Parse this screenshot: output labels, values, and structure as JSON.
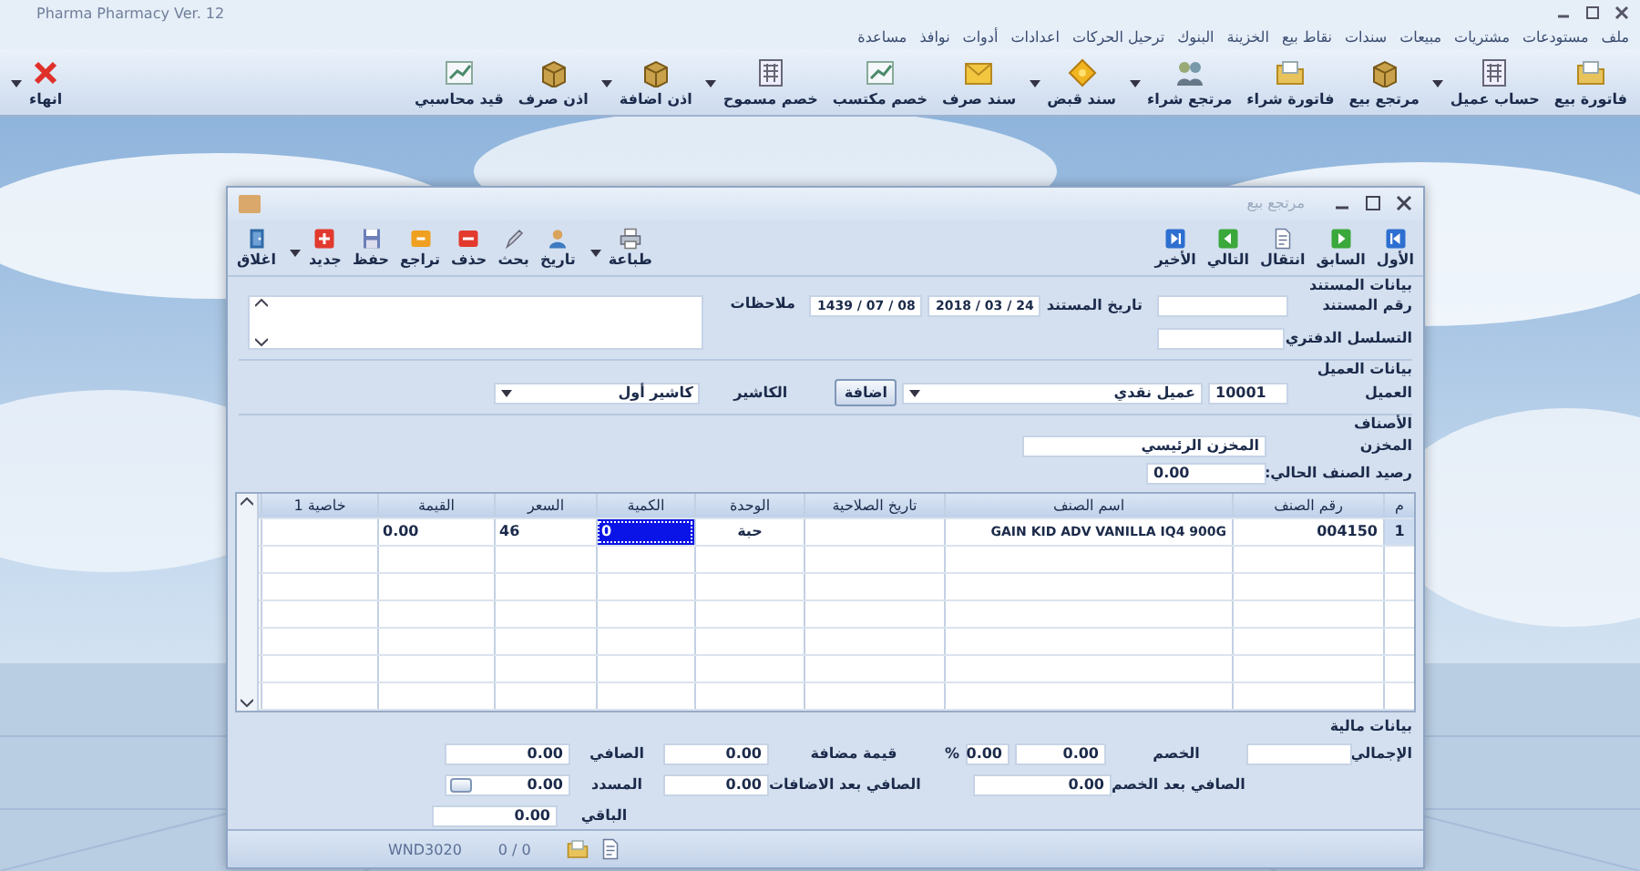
{
  "app": {
    "title": "Pharma Pharmacy Ver. 12"
  },
  "menu": [
    {
      "label": "ملف"
    },
    {
      "label": "مستودعات"
    },
    {
      "label": "مشتريات"
    },
    {
      "label": "مبيعات"
    },
    {
      "label": "سندات"
    },
    {
      "label": "نقاط بيع"
    },
    {
      "label": "الخزينة"
    },
    {
      "label": "البنوك"
    },
    {
      "label": "ترحيل الحركات"
    },
    {
      "label": "اعدادات"
    },
    {
      "label": "أدوات"
    },
    {
      "label": "نوافذ"
    },
    {
      "label": "مساعدة"
    }
  ],
  "toolbar": [
    {
      "label": "فاتورة بيع",
      "dropdown": false
    },
    {
      "label": "حساب عميل",
      "dropdown": true
    },
    {
      "label": "مرتجع بيع",
      "dropdown": false
    },
    {
      "label": "فاتورة شراء",
      "dropdown": false
    },
    {
      "label": "مرتجع شراء",
      "dropdown": true
    },
    {
      "label": "سند قبض",
      "dropdown": true
    },
    {
      "label": "سند صرف",
      "dropdown": false
    },
    {
      "label": "خصم مكتسب",
      "dropdown": false
    },
    {
      "label": "خصم مسموح",
      "dropdown": true
    },
    {
      "label": "اذن اضافة",
      "dropdown": true
    },
    {
      "label": "اذن صرف",
      "dropdown": false
    },
    {
      "label": "قيد محاسبي",
      "dropdown": false
    },
    {
      "label": "انهاء",
      "dropdown": true
    }
  ],
  "dialog": {
    "title": "مرتجع بيع",
    "nav": [
      {
        "label": "الأول"
      },
      {
        "label": "السابق"
      },
      {
        "label": "انتقال"
      },
      {
        "label": "التالي"
      },
      {
        "label": "الأخير"
      }
    ],
    "actions": [
      {
        "label": "طباعة",
        "dropdown": true
      },
      {
        "label": "تاريخ",
        "dropdown": false
      },
      {
        "label": "بحث",
        "dropdown": false
      },
      {
        "label": "حذف",
        "dropdown": false
      },
      {
        "label": "تراجع",
        "dropdown": false
      },
      {
        "label": "حفظ",
        "dropdown": false
      },
      {
        "label": "جديد",
        "dropdown": true
      },
      {
        "label": "اغلاق",
        "dropdown": false
      }
    ],
    "document": {
      "heading": "بيانات المستند",
      "number_label": "رقم المستند",
      "serial_label": "التسلسل الدفتري",
      "date_label": "تاريخ المستند",
      "date": "2018 / 03 / 24",
      "hijri_date": "1439 / 07 / 08",
      "notes_label": "ملاحظات"
    },
    "customer": {
      "heading": "بيانات العميل",
      "label": "العميل",
      "code": "10001",
      "name": "عميل نقدي",
      "add_button": "اضافة",
      "cashier_label": "الكاشير",
      "cashier": "كاشير أول"
    },
    "items": {
      "heading": "الأصناف",
      "store_label": "المخزن",
      "store": "المخزن الرئيسي",
      "balance_label": "رصيد الصنف الحالي:",
      "balance": "0.00"
    },
    "grid": {
      "columns": [
        "م",
        "رقم الصنف",
        "اسم الصنف",
        "تاريخ الصلاحية",
        "الوحدة",
        "الكمية",
        "السعر",
        "القيمة",
        "خاصية 1"
      ],
      "rows": [
        {
          "cells": [
            {
              "text": "1",
              "selected": false
            },
            {
              "text": "004150",
              "selected": false
            },
            {
              "text": "GAIN KID ADV VANILLA IQ4 900G",
              "selected": false
            },
            {
              "text": "",
              "selected": false
            },
            {
              "text": "حبة",
              "selected": false
            },
            {
              "text": "0",
              "selected": true
            },
            {
              "text": "46",
              "selected": false
            },
            {
              "text": "0.00",
              "selected": false
            },
            {
              "text": "",
              "selected": false
            }
          ]
        }
      ]
    },
    "finance": {
      "heading": "بيانات مالية",
      "fields": [
        {
          "label": "الإجمالي"
        },
        {
          "label": "الخصم",
          "value": "0.00",
          "percent": "0.00",
          "unit": "%"
        },
        {
          "label": "قيمة مضافة",
          "value": "0.00"
        },
        {
          "label": "الصافي",
          "value": "0.00"
        },
        {
          "label": "الصافي بعد الخصم",
          "value": "0.00"
        },
        {
          "label": "الصافي بعد الاضافات",
          "value": "0.00"
        },
        {
          "label": "المسدد",
          "value": "0.00",
          "button": true
        },
        {
          "label": "الباقي",
          "value": "0.00"
        }
      ]
    },
    "status_bar": {
      "window_code": "WND3020",
      "record": "0 / 0"
    }
  }
}
